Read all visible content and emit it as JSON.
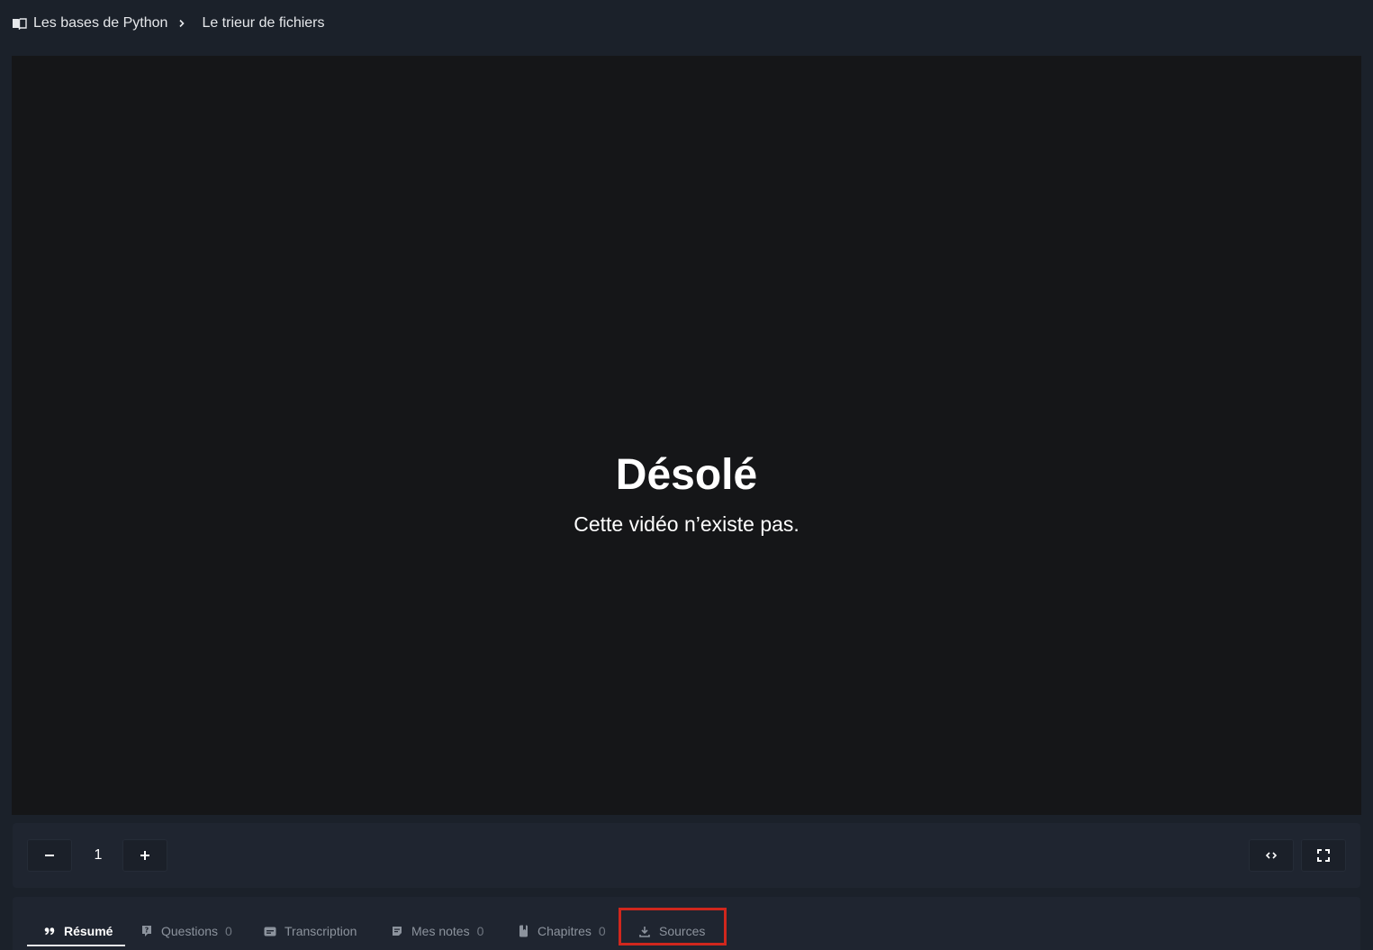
{
  "breadcrumb": {
    "course": "Les bases de Python",
    "lesson": "Le trieur de fichiers"
  },
  "video": {
    "title": "Désolé",
    "message": "Cette vidéo n’existe pas."
  },
  "controls": {
    "speed_value": "1"
  },
  "tabs": [
    {
      "label": "Résumé",
      "count": "",
      "icon": "quote-icon",
      "active": true
    },
    {
      "label": "Questions",
      "count": "0",
      "icon": "question-icon"
    },
    {
      "label": "Transcription",
      "count": "",
      "icon": "subtitles-icon"
    },
    {
      "label": "Mes notes",
      "count": "0",
      "icon": "note-icon"
    },
    {
      "label": "Chapitres",
      "count": "0",
      "icon": "bookmark-icon"
    },
    {
      "label": "Sources",
      "count": "",
      "icon": "download-icon"
    }
  ],
  "colors": {
    "background": "#1b212a",
    "video_background": "#151618",
    "highlight": "#d0271d"
  }
}
